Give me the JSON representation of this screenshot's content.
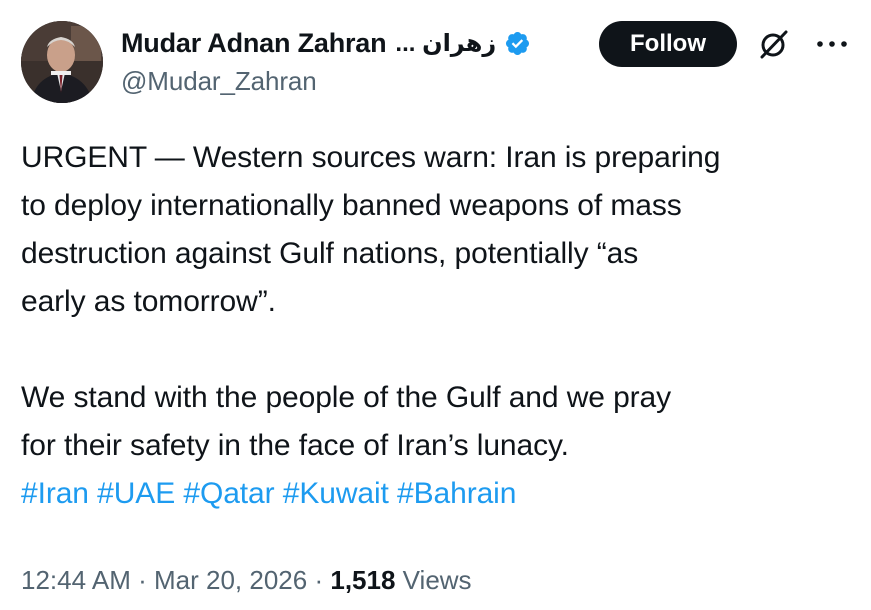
{
  "author": {
    "display_name": "Mudar Adnan Zahran",
    "display_name_arabic": "... زهران",
    "handle": "@Mudar_Zahran",
    "verified": true,
    "verified_color": "#1d9bf0"
  },
  "actions": {
    "follow_label": "Follow",
    "grok_icon": "grok-icon",
    "more_icon": "more-dots-icon"
  },
  "tweet": {
    "lines": [
      "URGENT — Western sources warn: Iran is preparing",
      "to deploy internationally banned weapons of mass",
      "destruction against Gulf nations, potentially “as",
      "early as tomorrow”."
    ],
    "lines2": [
      "We stand with the people of the Gulf and we pray",
      "for their safety in the face of Iran’s lunacy."
    ],
    "hashtags": [
      "#Iran",
      "#UAE",
      "#Qatar",
      "#Kuwait",
      "#Bahrain"
    ]
  },
  "meta": {
    "time": "12:44 AM",
    "date": "Mar 20, 2026",
    "views_count": "1,518",
    "views_label": "Views",
    "separator": "·"
  },
  "colors": {
    "text": "#0f1419",
    "secondary": "#536471",
    "link": "#1d9bf0",
    "button_bg": "#0f1419"
  }
}
